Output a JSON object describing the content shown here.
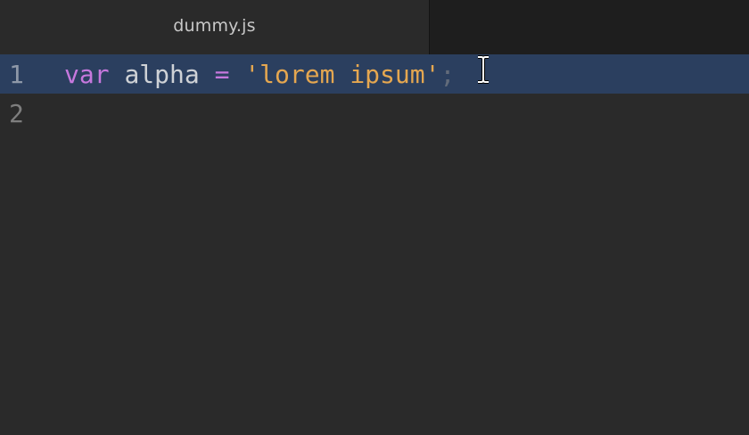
{
  "tab": {
    "title": "dummy.js"
  },
  "editor": {
    "lines": [
      {
        "number": "1",
        "tokens": {
          "keyword": "var",
          "identifier": "alpha",
          "operator": "=",
          "string": "'lorem ipsum'",
          "punct": ";"
        }
      },
      {
        "number": "2"
      }
    ]
  },
  "colors": {
    "background": "#2a2a2a",
    "active_line": "#2b3f5f",
    "keyword": "#c678dd",
    "string": "#e5a750"
  },
  "cursor": {
    "icon": "text-cursor-icon"
  }
}
